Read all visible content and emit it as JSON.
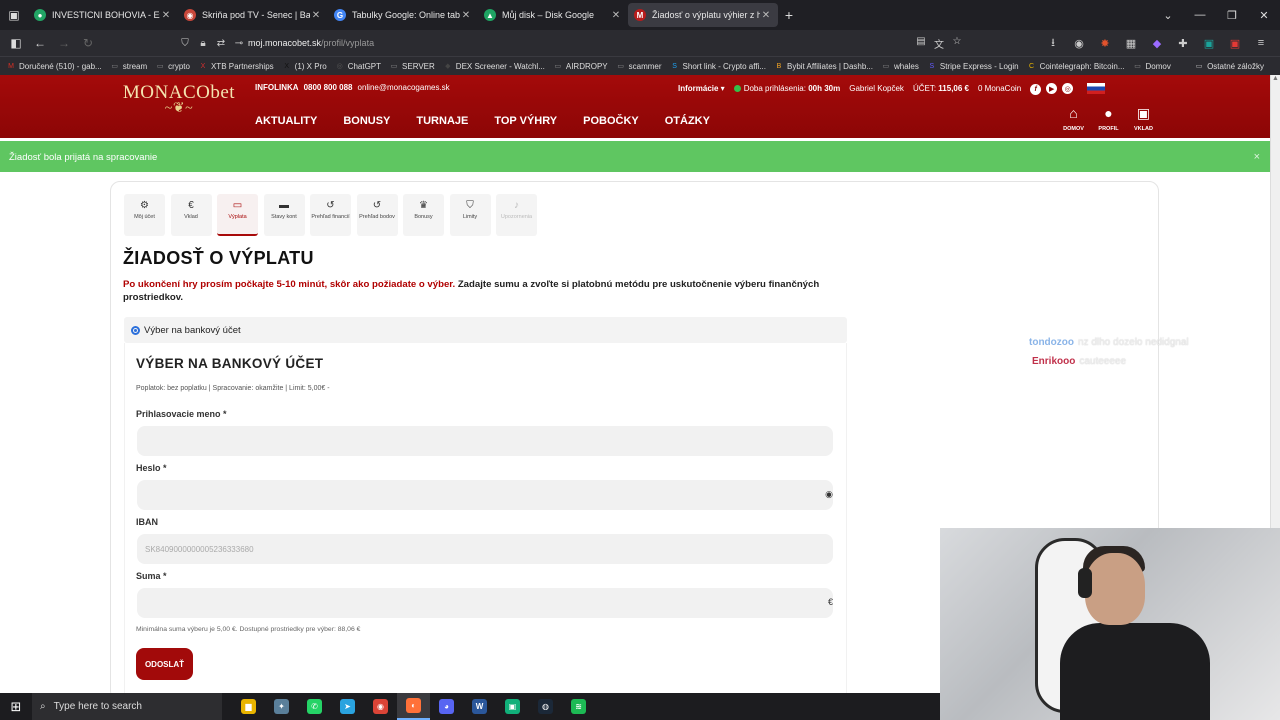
{
  "browser": {
    "tabs": [
      {
        "title": "INVESTICNI BOHOVIA - Excel ve",
        "favicon": "●",
        "color": "#22a565",
        "active": false
      },
      {
        "title": "Skriňa pod TV - Senec | Bazoš.sk",
        "favicon": "◉",
        "color": "#c8473a",
        "active": false
      },
      {
        "title": "Tabulky Google: Online tabulky",
        "favicon": "G",
        "color": "#4285f4",
        "active": false
      },
      {
        "title": "Můj disk – Disk Google",
        "favicon": "▲",
        "color": "#1fa463",
        "active": false
      },
      {
        "title": "Žiadosť o výplatu výhier z h",
        "favicon": "M",
        "color": "#b71c1c",
        "active": true
      }
    ],
    "url_host": "moj.monacobet.sk",
    "url_path": "/profil/vyplata",
    "bookmarks": [
      {
        "label": "Doručené (510) - gab...",
        "icon": "M",
        "color": "#d93025"
      },
      {
        "label": "stream",
        "icon": "▭",
        "color": "#888"
      },
      {
        "label": "crypto",
        "icon": "▭",
        "color": "#888"
      },
      {
        "label": "XTB Partnerships",
        "icon": "X",
        "color": "#d32f2f"
      },
      {
        "label": "(1) X Pro",
        "icon": "X",
        "color": "#111"
      },
      {
        "label": "ChatGPT",
        "icon": "◎",
        "color": "#555"
      },
      {
        "label": "SERVER",
        "icon": "▭",
        "color": "#888"
      },
      {
        "label": "DEX Screener - Watchl...",
        "icon": "◆",
        "color": "#444"
      },
      {
        "label": "AIRDROPY",
        "icon": "▭",
        "color": "#888"
      },
      {
        "label": "scammer",
        "icon": "▭",
        "color": "#888"
      },
      {
        "label": "Short link - Crypto affi...",
        "icon": "S",
        "color": "#1da1f2"
      },
      {
        "label": "Bybit Affiliates | Dashb...",
        "icon": "B",
        "color": "#f5a623"
      },
      {
        "label": "whales",
        "icon": "▭",
        "color": "#888"
      },
      {
        "label": "Stripe Express - Login",
        "icon": "S",
        "color": "#635bff"
      },
      {
        "label": "Cointelegraph: Bitcoin...",
        "icon": "C",
        "color": "#e8b500"
      },
      {
        "label": "Domov",
        "icon": "▭",
        "color": "#888"
      }
    ],
    "other_bookmarks": "Ostatné záložky"
  },
  "header": {
    "logo": "MONACObet",
    "infoline_label": "INFOLINKA",
    "phone": "0800 800 088",
    "email": "online@monacogames.sk",
    "informacie": "Informácie ▾",
    "login_time_label": "Doba prihlásenia:",
    "login_time": "00h 30m",
    "user_name": "Gabriel Kopček",
    "account_label": "ÚČET:",
    "account_balance": "115,06 €",
    "monacoin": "0 MonaCoin",
    "nav": [
      "AKTUALITY",
      "BONUSY",
      "TURNAJE",
      "TOP VÝHRY",
      "POBOČKY",
      "OTÁZKY"
    ],
    "icons": [
      {
        "label": "DOMOV",
        "glyph": "⌂"
      },
      {
        "label": "PROFIL",
        "glyph": "●"
      },
      {
        "label": "VKLAD",
        "glyph": "▣"
      }
    ]
  },
  "alert": {
    "text": "Žiadosť bola prijatá na spracovanie",
    "close": "×"
  },
  "account_menu": [
    {
      "label": "Môj účet",
      "glyph": "⚙",
      "state": "normal"
    },
    {
      "label": "Vklad",
      "glyph": "€",
      "state": "normal"
    },
    {
      "label": "Výplata",
      "glyph": "▭",
      "state": "active"
    },
    {
      "label": "Stavy kont",
      "glyph": "▬",
      "state": "normal"
    },
    {
      "label": "Prehľad financií",
      "glyph": "↺",
      "state": "normal"
    },
    {
      "label": "Prehľad bodov",
      "glyph": "↺",
      "state": "normal"
    },
    {
      "label": "Bonusy",
      "glyph": "♛",
      "state": "normal"
    },
    {
      "label": "Limity",
      "glyph": "⛉",
      "state": "normal"
    },
    {
      "label": "Upozornenia",
      "glyph": "♪",
      "state": "muted"
    }
  ],
  "page": {
    "title": "ŽIADOSŤ O VÝPLATU",
    "intro_red": "Po ukončení hry prosím počkajte 5-10 minút, skôr ako požiadate o výber.",
    "intro_rest": " Zadajte sumu a zvoľte si platobnú metódu pre uskutočnenie výberu finančných prostriedkov.",
    "method_label": "Výber na bankový účet"
  },
  "form": {
    "title": "VÝBER NA BANKOVÝ ÚČET",
    "meta": "Poplatok: bez poplatku | Spracovanie: okamžite | Limit: 5,00€ -",
    "username_label": "Prihlasovacie meno *",
    "username_value": "",
    "password_label": "Heslo *",
    "password_value": "",
    "iban_label": "IBAN",
    "iban_placeholder": "SK8409000000005236333680",
    "amount_label": "Suma *",
    "amount_value": "",
    "currency": "€",
    "hint": "Minimálna suma výberu je 5,00 €. Dostupné prostriedky pre výber: 88,06 €",
    "submit": "ODOSLAŤ"
  },
  "chat": [
    {
      "user": "tondozoo",
      "message": "nz dlho dozelo nedidgnal",
      "color": "#8ab4e8"
    },
    {
      "user": "Enrikooo",
      "message": "cauteeeee",
      "color": "#c0304a"
    }
  ],
  "taskbar": {
    "search_placeholder": "Type here to search",
    "apps": [
      {
        "name": "file-explorer",
        "glyph": "▆",
        "color": "#e8b400"
      },
      {
        "name": "settings",
        "glyph": "✦",
        "color": "#5a7f9a"
      },
      {
        "name": "whatsapp",
        "glyph": "✆",
        "color": "#25d366"
      },
      {
        "name": "telegram",
        "glyph": "➤",
        "color": "#2aa3df"
      },
      {
        "name": "chrome",
        "glyph": "◉",
        "color": "#db4437"
      },
      {
        "name": "firefox",
        "glyph": "◐",
        "color": "#ff7139"
      },
      {
        "name": "discord",
        "glyph": "◕",
        "color": "#5865f2"
      },
      {
        "name": "word",
        "glyph": "W",
        "color": "#2b579a"
      },
      {
        "name": "app-green",
        "glyph": "▣",
        "color": "#11b07a"
      },
      {
        "name": "steam",
        "glyph": "◍",
        "color": "#1b2838"
      },
      {
        "name": "spotify",
        "glyph": "≋",
        "color": "#1db954"
      }
    ]
  }
}
